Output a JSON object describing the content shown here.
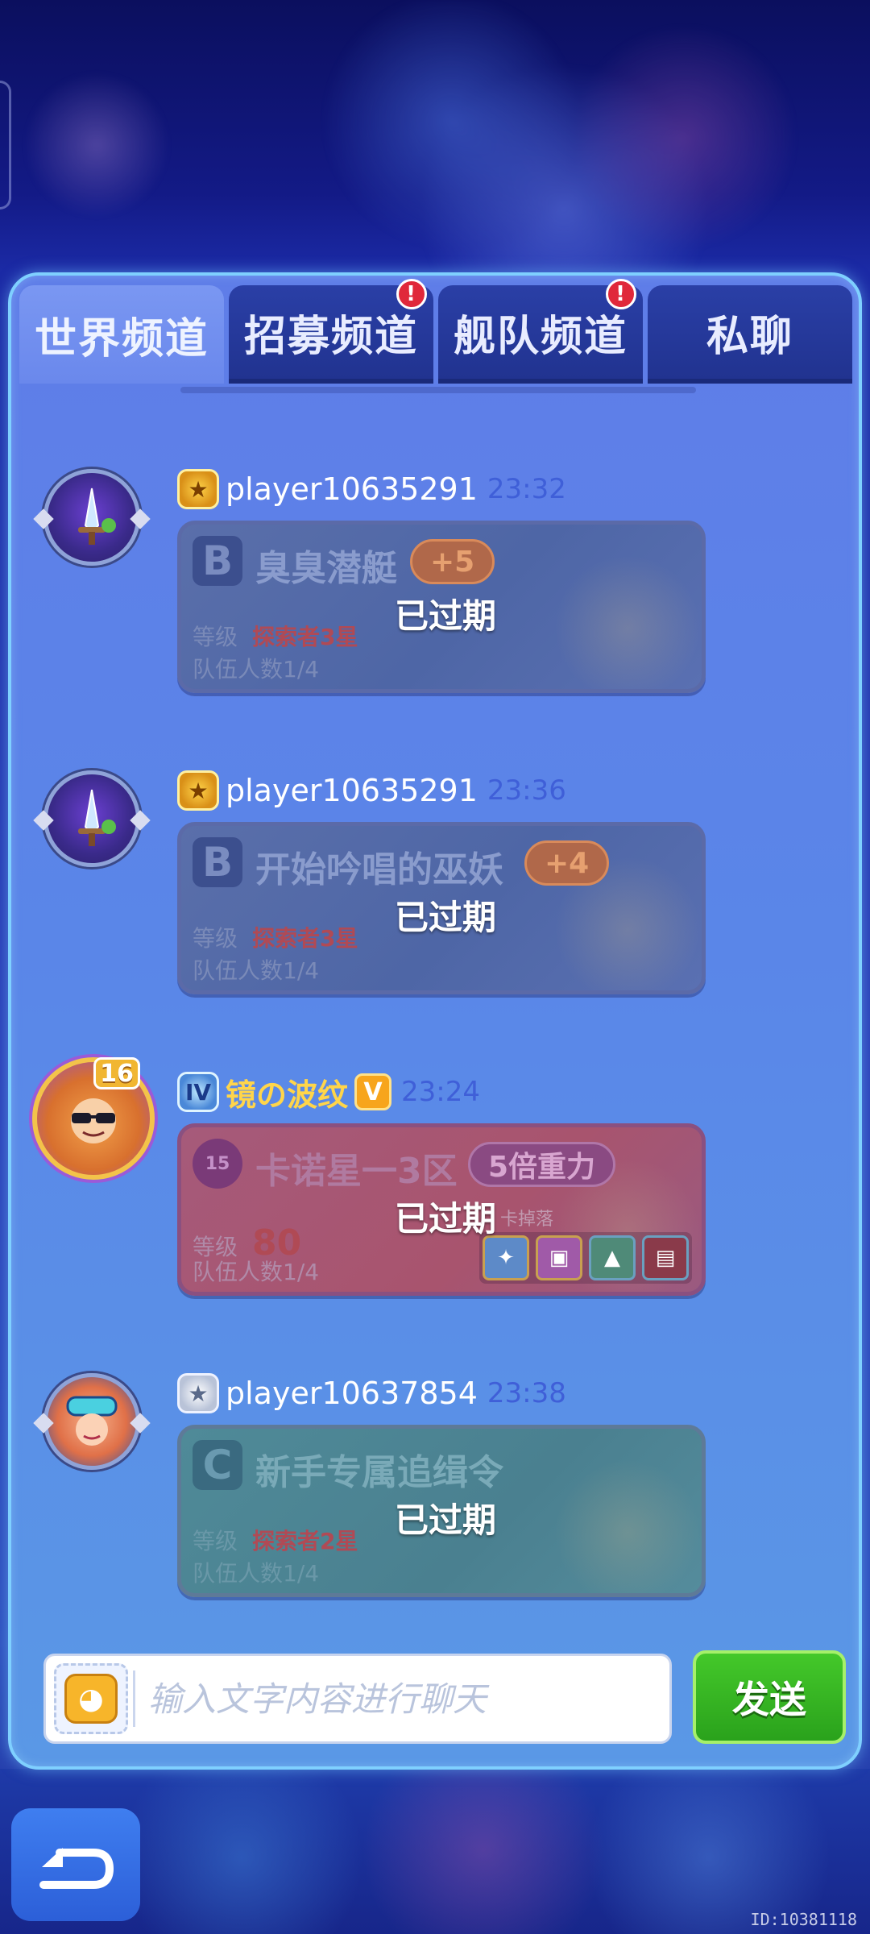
{
  "tabs": [
    {
      "label": "世界频道",
      "active": true,
      "alert": false
    },
    {
      "label": "招募频道",
      "active": false,
      "alert": true
    },
    {
      "label": "舰队频道",
      "active": false,
      "alert": true
    },
    {
      "label": "私聊",
      "active": false,
      "alert": false
    }
  ],
  "alert_mark": "!",
  "messages": [
    {
      "player": "player10635291",
      "time": "23:32",
      "card": {
        "grade": "B",
        "title": "臭臭潜艇",
        "bonus": "+5",
        "level_label": "等级",
        "level_value": "探索者3星",
        "team": "队伍人数1/4",
        "status": "已过期"
      }
    },
    {
      "player": "player10635291",
      "time": "23:36",
      "card": {
        "grade": "B",
        "title": "开始吟唱的巫妖",
        "bonus": "+4",
        "level_label": "等级",
        "level_value": "探索者3星",
        "team": "队伍人数1/4",
        "status": "已过期"
      }
    },
    {
      "player": "镜の波纹",
      "player_level": "16",
      "vip_mark": "V",
      "time": "23:24",
      "card": {
        "grade": "15",
        "title": "卡诺星一3区",
        "bonus": "5倍重力",
        "level_label": "等级",
        "level_value": "80",
        "drops_label": "卡掉落",
        "team": "队伍人数1/4",
        "status": "已过期"
      }
    },
    {
      "player": "player10637854",
      "time": "23:38",
      "card": {
        "grade": "C",
        "title": "新手专属追缉令",
        "level_label": "等级",
        "level_value": "探索者2星",
        "team": "队伍人数1/4",
        "status": "已过期"
      }
    }
  ],
  "input": {
    "placeholder": "输入文字内容进行聊天",
    "value": ""
  },
  "send_label": "发送",
  "build_id": "ID:10381118",
  "icons": {
    "avatar_1": "sword-avatar-icon",
    "avatar_3": "sunglasses-avatar-icon",
    "avatar_4": "goggles-girl-avatar-icon",
    "rank_gold": "gold-rank-icon",
    "rank_silver": "silver-rank-icon",
    "rank_blue": "blue-rank-icon",
    "emoji": "emoji-icon",
    "back": "back-arrow-icon"
  },
  "colors": {
    "panel_border": "#7fd0ff",
    "send_button": "#2aa21c",
    "alert_badge": "#e0283a",
    "time_text": "#3f5fd8",
    "vip_name": "#ffd54a"
  }
}
